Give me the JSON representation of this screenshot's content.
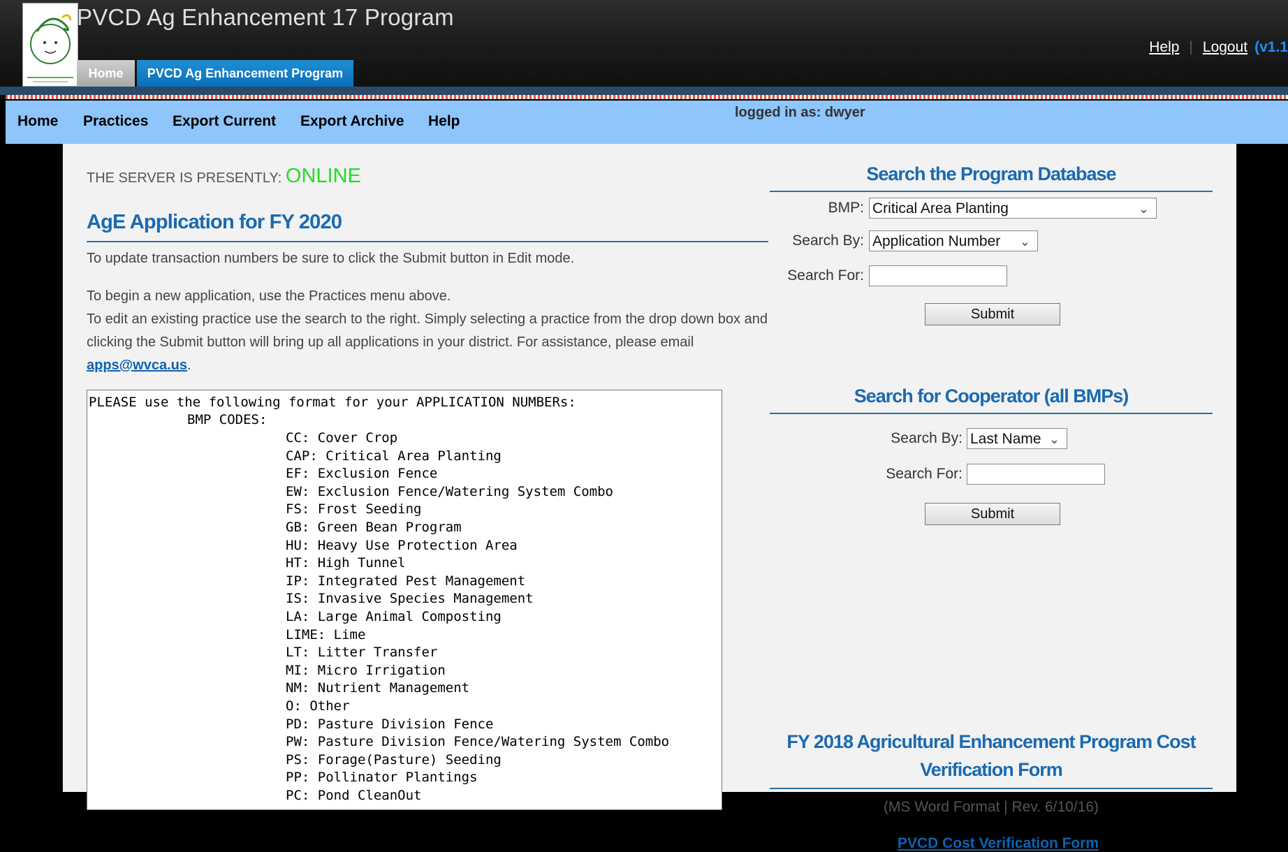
{
  "header": {
    "app_title": "PVCD Ag Enhancement 17 Program",
    "tabs": [
      {
        "label": "Home",
        "active": false
      },
      {
        "label": "PVCD Ag Enhancement Program",
        "active": true
      }
    ],
    "links": {
      "help": "Help",
      "logout": "Logout",
      "version": "(v1.1"
    }
  },
  "nav": {
    "items": [
      "Home",
      "Practices",
      "Export Current",
      "Export Archive",
      "Help"
    ],
    "logged_in": "logged in as: dwyer"
  },
  "main": {
    "server_status_label": "THE SERVER IS PRESENTLY:",
    "server_status_value": "ONLINE",
    "heading": "AgE Application for FY 2020",
    "para1": "To update transaction numbers be sure to click the Submit button in Edit mode.",
    "para2_line1": "To begin a new application, use the Practices menu above.",
    "para2_line2": "To edit an existing practice use the search to the right. Simply selecting a practice from the drop down box and clicking the Submit button will bring up all applications in your district. For assistance, please email ",
    "email": "apps@wvca.us",
    "para2_end": ".",
    "codes_intro": "PLEASE use the following format for your APPLICATION NUMBERs:",
    "codes_sub": "BMP CODES:",
    "codes": [
      "CC: Cover Crop",
      "CAP: Critical Area Planting",
      "EF: Exclusion Fence",
      "EW: Exclusion Fence/Watering System Combo",
      "FS: Frost Seeding",
      "GB: Green Bean Program",
      "HU: Heavy Use Protection Area",
      "HT: High Tunnel",
      "IP: Integrated Pest Management",
      "IS: Invasive Species Management",
      "LA: Large Animal Composting",
      "LIME: Lime",
      "LT: Litter Transfer",
      "MI: Micro Irrigation",
      "NM: Nutrient Management",
      "O: Other",
      "PD: Pasture Division Fence",
      "PW: Pasture Division Fence/Watering System Combo",
      "PS: Forage(Pasture) Seeding",
      "PP: Pollinator Plantings",
      "PC: Pond CleanOut"
    ]
  },
  "search_db": {
    "title": "Search the Program Database",
    "bmp_label": "BMP:",
    "bmp_value": "Critical Area Planting",
    "search_by_label": "Search By:",
    "search_by_value": "Application Number",
    "search_for_label": "Search For:",
    "search_for_value": "",
    "submit": "Submit"
  },
  "search_coop": {
    "title": "Search for Cooperator (all BMPs)",
    "search_by_label": "Search By:",
    "search_by_value": "Last Name",
    "search_for_label": "Search For:",
    "search_for_value": "",
    "submit": "Submit"
  },
  "cost_form": {
    "title_line1": "FY 2018 Agricultural Enhancement Program Cost",
    "title_line2": "Verification Form",
    "meta": "(MS Word Format | Rev. 6/10/16)",
    "link": "PVCD Cost Verification Form"
  }
}
